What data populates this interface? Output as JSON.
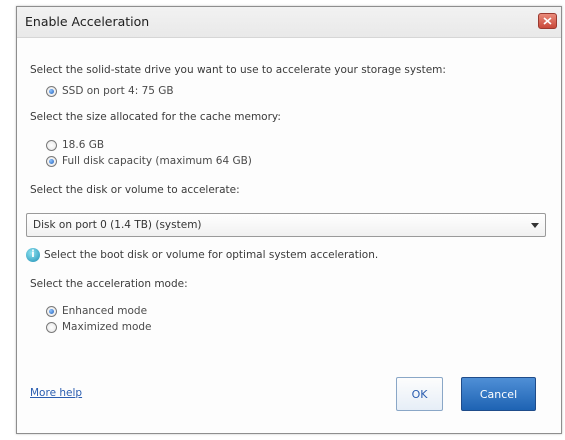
{
  "dialog": {
    "title": "Enable Acceleration",
    "close_icon": "close-icon"
  },
  "ssd": {
    "prompt": "Select the solid-state drive you want to use to accelerate your storage system:",
    "options": [
      {
        "label": "SSD on port 4: 75 GB",
        "checked": true
      }
    ]
  },
  "cache": {
    "prompt": "Select the size allocated for the cache memory:",
    "options": [
      {
        "label": "18.6 GB",
        "checked": false
      },
      {
        "label": "Full disk capacity (maximum 64 GB)",
        "checked": true
      }
    ]
  },
  "volume": {
    "prompt": "Select the disk or volume to accelerate:",
    "selected": "Disk on port 0 (1.4 TB) (system)",
    "hint_icon": "info-icon",
    "hint": "Select the boot disk or volume for optimal system acceleration."
  },
  "mode": {
    "prompt": "Select the acceleration mode:",
    "options": [
      {
        "label": "Enhanced mode",
        "checked": true
      },
      {
        "label": "Maximized mode",
        "checked": false
      }
    ]
  },
  "footer": {
    "more_help": "More help",
    "ok_label": "OK",
    "cancel_label": "Cancel"
  },
  "colors": {
    "accent": "#1e63b3",
    "link": "#2a5db0",
    "close": "#c9493a",
    "info": "#1f8fb5"
  }
}
